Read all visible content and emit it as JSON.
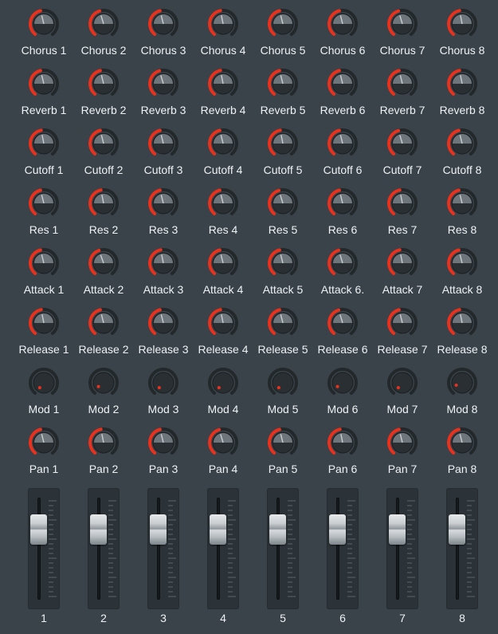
{
  "colors": {
    "background": "#3a434a",
    "knob_face": "#2a2f33",
    "knob_track": "#23282b",
    "accent_arc": "#e8321e",
    "label": "#eef2f4"
  },
  "knob_rows": [
    {
      "kind": "chorus",
      "style": "arc",
      "labels": [
        "Chorus 1",
        "Chorus 2",
        "Chorus 3",
        "Chorus 4",
        "Chorus 5",
        "Chorus 6",
        "Chorus 7",
        "Chorus 8"
      ],
      "values": [
        0.45,
        0.44,
        0.45,
        0.46,
        0.45,
        0.45,
        0.44,
        0.46
      ]
    },
    {
      "kind": "reverb",
      "style": "arc",
      "labels": [
        "Reverb 1",
        "Reverb 2",
        "Reverb 3",
        "Reverb 4",
        "Reverb 5",
        "Reverb 6",
        "Reverb 7",
        "Reverb 8"
      ],
      "values": [
        0.45,
        0.45,
        0.44,
        0.46,
        0.45,
        0.45,
        0.45,
        0.46
      ]
    },
    {
      "kind": "cutoff",
      "style": "arc",
      "labels": [
        "Cutoff 1",
        "Cutoff 2",
        "Cutoff 3",
        "Cutoff 4",
        "Cutoff 5",
        "Cutoff 6",
        "Cutoff 7",
        "Cutoff 8"
      ],
      "values": [
        0.46,
        0.45,
        0.45,
        0.45,
        0.46,
        0.45,
        0.44,
        0.45
      ]
    },
    {
      "kind": "res",
      "style": "arc",
      "labels": [
        "Res 1",
        "Res 2",
        "Res 3",
        "Res 4",
        "Res 5",
        "Res 6",
        "Res 7",
        "Res 8"
      ],
      "values": [
        0.45,
        0.46,
        0.45,
        0.45,
        0.44,
        0.45,
        0.46,
        0.45
      ]
    },
    {
      "kind": "attack",
      "style": "arc",
      "labels": [
        "Attack 1",
        "Attack 2",
        "Attack 3",
        "Attack 4",
        "Attack 5",
        "Attack 6.",
        "Attack 7",
        "Attack 8"
      ],
      "values": [
        0.45,
        0.43,
        0.46,
        0.45,
        0.45,
        0.44,
        0.46,
        0.45
      ]
    },
    {
      "kind": "release",
      "style": "arc",
      "labels": [
        "Release 1",
        "Release 2",
        "Release 3",
        "Release 4",
        "Release 5",
        "Release 6",
        "Release 7",
        "Release 8"
      ],
      "values": [
        0.46,
        0.45,
        0.45,
        0.46,
        0.45,
        0.44,
        0.45,
        0.46
      ]
    },
    {
      "kind": "mod",
      "style": "dot",
      "labels": [
        "Mod 1",
        "Mod 2",
        "Mod 3",
        "Mod 4",
        "Mod 5",
        "Mod 6",
        "Mod 7",
        "Mod 8"
      ],
      "values": [
        0.0,
        0.05,
        0.0,
        0.0,
        0.0,
        0.05,
        0.0,
        0.1
      ]
    },
    {
      "kind": "pan",
      "style": "arc",
      "labels": [
        "Pan 1",
        "Pan 2",
        "Pan 3",
        "Pan 4",
        "Pan 5",
        "Pan 6",
        "Pan 7",
        "Pan 8"
      ],
      "values": [
        0.45,
        0.46,
        0.45,
        0.44,
        0.45,
        0.46,
        0.45,
        0.45
      ]
    }
  ],
  "faders": [
    {
      "label": "1",
      "value": 0.8
    },
    {
      "label": "2",
      "value": 0.8
    },
    {
      "label": "3",
      "value": 0.8
    },
    {
      "label": "4",
      "value": 0.8
    },
    {
      "label": "5",
      "value": 0.8
    },
    {
      "label": "6",
      "value": 0.8
    },
    {
      "label": "7",
      "value": 0.8
    },
    {
      "label": "8",
      "value": 0.8
    }
  ]
}
